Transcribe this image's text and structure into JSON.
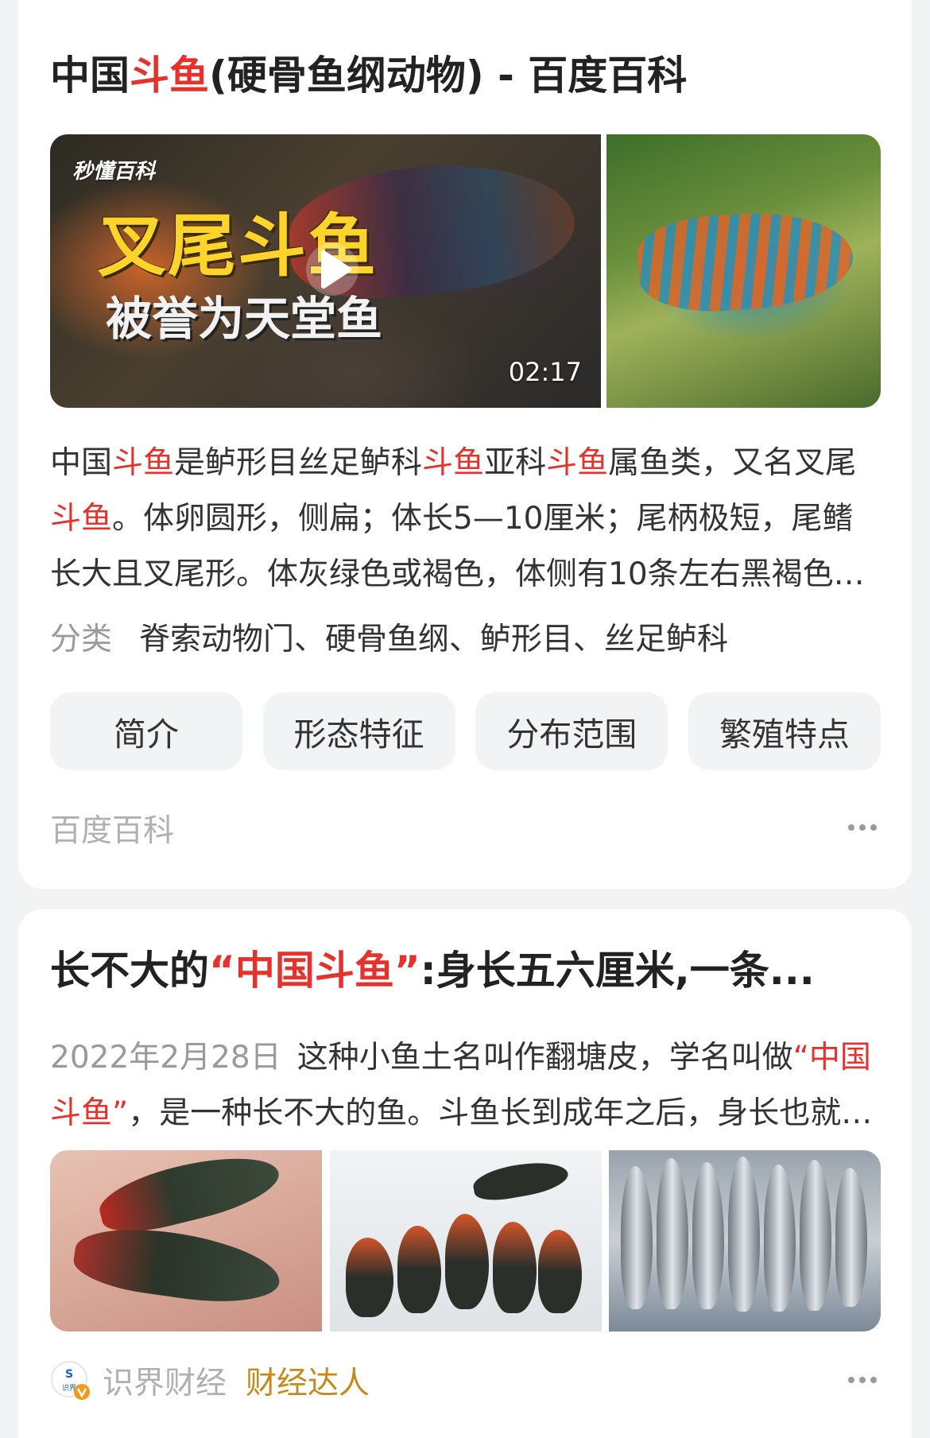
{
  "result1": {
    "title_prefix": "中国",
    "title_highlight": "斗鱼",
    "title_suffix": "(硬骨鱼纲动物) - 百度百科",
    "video": {
      "brand": "秒懂百科",
      "overlay_title": "叉尾斗鱼",
      "overlay_subtitle": "被誉为天堂鱼",
      "duration": "02:17"
    },
    "description_parts": [
      {
        "text": "中国",
        "hl": false
      },
      {
        "text": "斗鱼",
        "hl": true
      },
      {
        "text": "是鲈形目丝足鲈科",
        "hl": false
      },
      {
        "text": "斗鱼",
        "hl": true
      },
      {
        "text": "亚科",
        "hl": false
      },
      {
        "text": "斗鱼",
        "hl": true
      },
      {
        "text": "属鱼类，又名叉尾",
        "hl": false
      },
      {
        "text": "斗鱼",
        "hl": true
      },
      {
        "text": "。体卵圆形，侧扁；体长5—10厘米；尾柄极短，尾鳍长大且叉尾形。体灰绿色或褐色，体侧有10条左右黑褐色的横带...",
        "hl": false
      }
    ],
    "classify_label": "分类",
    "classify_value": "脊索动物门、硬骨鱼纲、鲈形目、丝足鲈科",
    "chips": [
      "简介",
      "形态特征",
      "分布范围",
      "繁殖特点"
    ],
    "source": "百度百科"
  },
  "result2": {
    "title_prefix": "长不大的",
    "title_highlight": "“中国斗鱼”",
    "title_suffix": ":身长五六厘米,一条...",
    "date": "2022年2月28日",
    "snippet_parts": [
      {
        "text": "这种小鱼土名叫作翻塘皮，学名叫做",
        "hl": false
      },
      {
        "text": "“中国斗鱼”",
        "hl": true
      },
      {
        "text": "，是一种长不大的鱼。斗鱼长到成年之后，身长也就五六厘米...",
        "hl": false
      }
    ],
    "author": "识界财经",
    "author_badge": "财经达人",
    "avatar_text": "识界"
  },
  "colors": {
    "highlight": "#e5322d",
    "badge": "#c58a1a",
    "chip_bg": "#f2f3f5"
  }
}
